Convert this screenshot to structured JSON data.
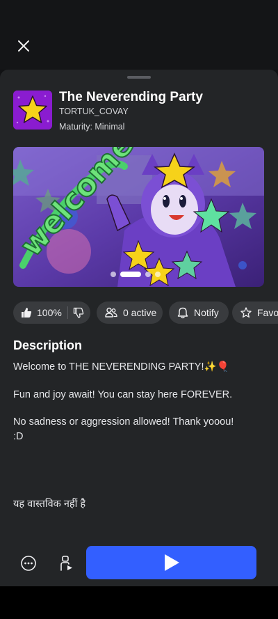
{
  "game": {
    "title": "The Neverending Party",
    "creator": "TORTUK_COVAY",
    "maturity": "Maturity: Minimal",
    "icon": "star-game-icon"
  },
  "thumbnail": {
    "text": "welcome",
    "slides": 4,
    "active_slide": 1
  },
  "chips": {
    "rating": "100%",
    "active": "0 active",
    "notify": "Notify",
    "favorite": "Favorite"
  },
  "description": {
    "heading": "Description",
    "lines": [
      "Welcome to THE NEVERENDING PARTY!✨🎈",
      "Fun and joy await! You can stay here FOREVER.",
      "No sadness or aggression allowed! Thank yooou!",
      ":D",
      "यह वास्तविक नहीं है"
    ]
  },
  "icons": {
    "close": "close-icon",
    "thumbs_up": "thumbs-up-icon",
    "thumbs_down": "thumbs-down-icon",
    "people": "people-icon",
    "bell": "bell-icon",
    "star": "star-icon",
    "more": "more-icon",
    "avatar": "avatar-icon",
    "play": "play-icon"
  },
  "colors": {
    "background": "#232527",
    "chip": "#393b3e",
    "play": "#335fff",
    "game_icon_bg": "#8a1cd0",
    "star": "#f6d21a"
  }
}
